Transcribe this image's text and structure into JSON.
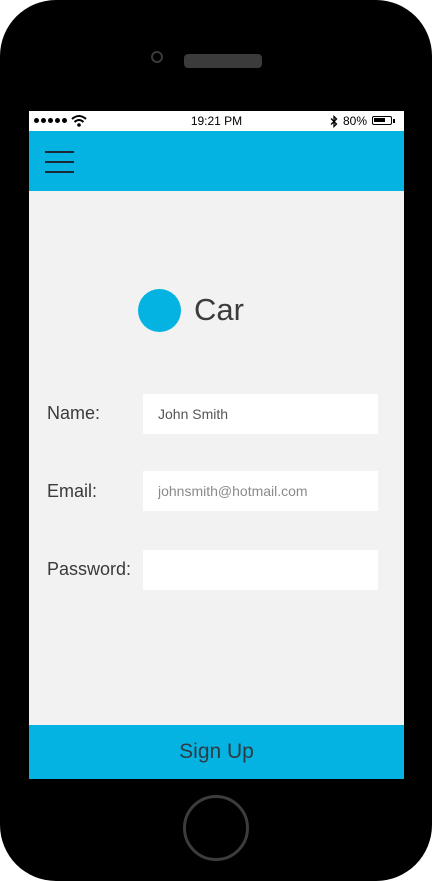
{
  "status_bar": {
    "time": "19:21 PM",
    "battery_percent_text": "80%",
    "battery_level": 0.8
  },
  "app": {
    "logo_text": "Car",
    "accent_color": "#04b3e2"
  },
  "form": {
    "name_label": "Name:",
    "name_value": "John Smith",
    "email_label": "Email:",
    "email_placeholder": "johnsmith@hotmail.com",
    "password_label": "Password:",
    "password_value": ""
  },
  "actions": {
    "signup_label": "Sign Up"
  },
  "icons": {
    "menu": "hamburger-menu-icon",
    "wifi": "wifi-icon",
    "bluetooth": "bluetooth-icon",
    "battery": "battery-icon",
    "signal": "signal-dots-icon"
  }
}
